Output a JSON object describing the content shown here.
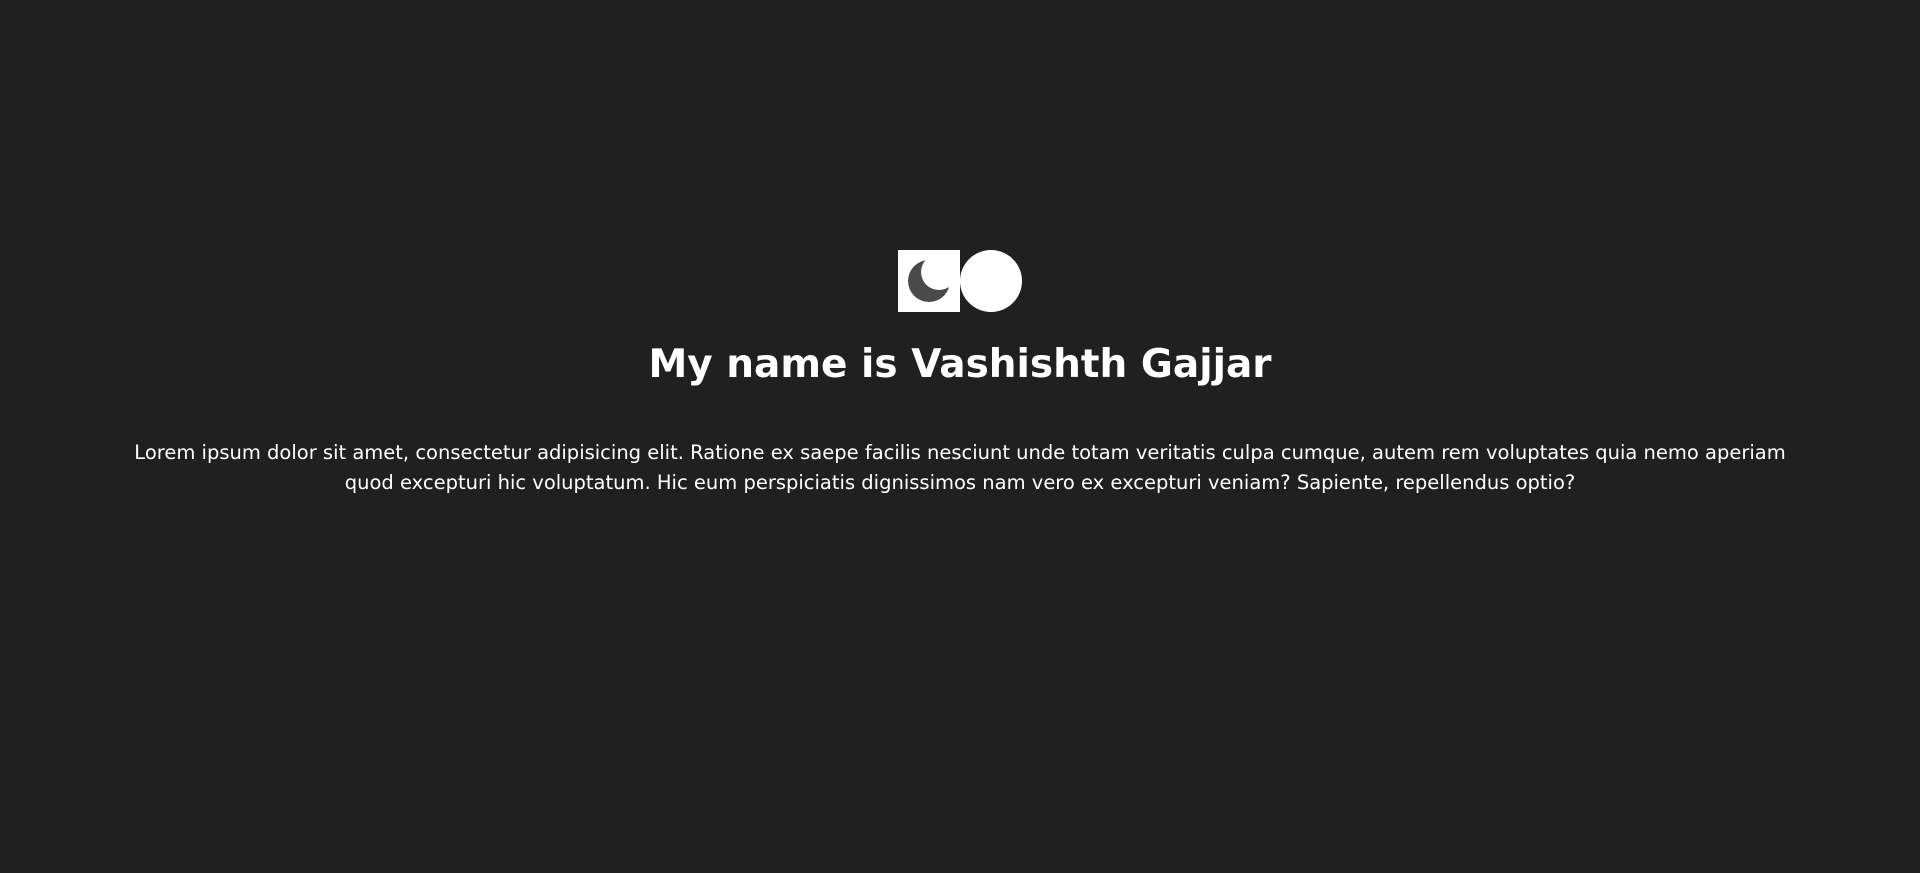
{
  "header": {
    "theme_toggle": {
      "left_icon": "moon-icon",
      "right_icon": "sun-circle-icon"
    }
  },
  "main": {
    "title": "My name is Vashishth Gajjar",
    "description": "Lorem ipsum dolor sit amet, consectetur adipisicing elit. Ratione ex saepe facilis nesciunt unde totam veritatis culpa cumque, autem rem voluptates quia nemo aperiam quod excepturi hic voluptatum. Hic eum perspiciatis dignissimos nam vero ex excepturi veniam? Sapiente, repellendus optio?"
  },
  "colors": {
    "background": "#202020",
    "text": "#ffffff",
    "moon": "#4a4a4a"
  }
}
